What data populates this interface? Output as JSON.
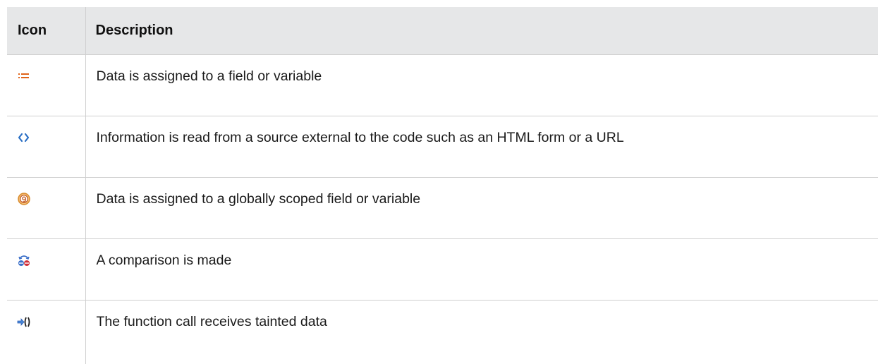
{
  "table": {
    "headers": {
      "icon": "Icon",
      "description": "Description"
    },
    "rows": [
      {
        "icon": "assignment-icon",
        "description": "Data is assigned to a field or variable"
      },
      {
        "icon": "external-source-icon",
        "description": "Information is read from a source external to the code such as an HTML form or a URL"
      },
      {
        "icon": "global-assignment-icon",
        "description": "Data is assigned to a globally scoped field or variable"
      },
      {
        "icon": "comparison-icon",
        "description": "A comparison is made"
      },
      {
        "icon": "tainted-call-icon",
        "description": "The function call receives tainted data"
      }
    ]
  },
  "colors": {
    "header_bg": "#e6e7e8",
    "border": "#cfcfcf",
    "assign_orange": "#e0641a",
    "external_blue": "#2b6fc4",
    "global_orange": "#d98a2b",
    "compare_blue": "#3b6fc9",
    "compare_red": "#d0303a",
    "call_blue": "#2d5fb5"
  }
}
